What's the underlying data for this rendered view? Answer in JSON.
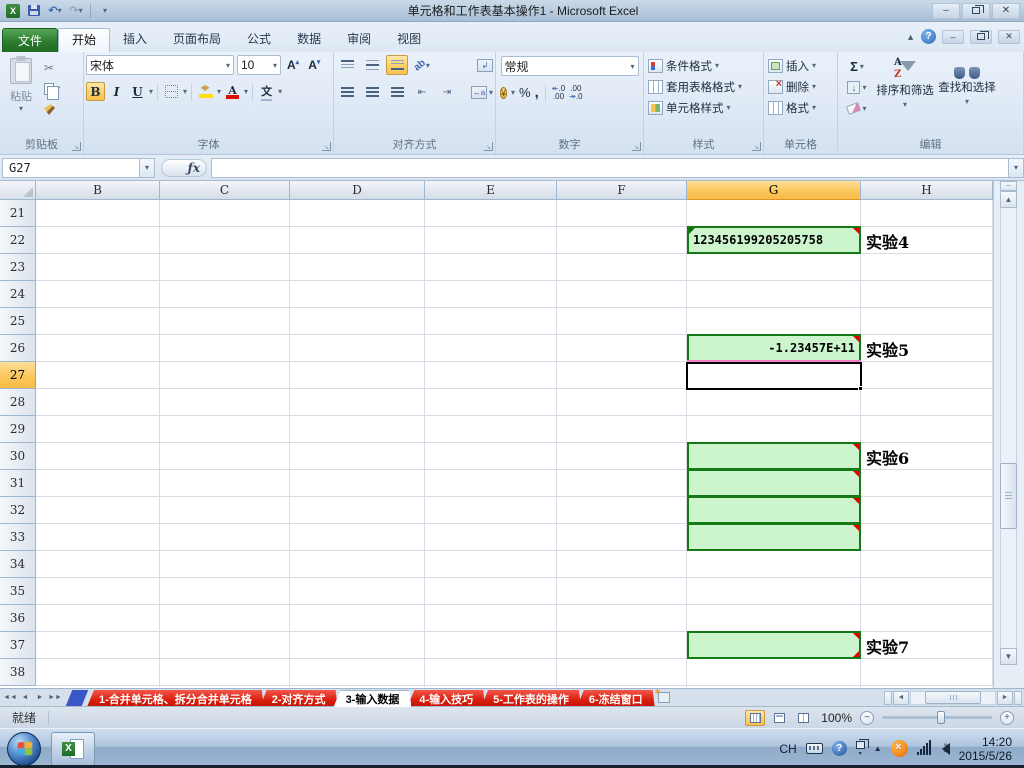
{
  "window": {
    "title": "单元格和工作表基本操作1 - Microsoft Excel"
  },
  "ribbon": {
    "file_tab": "文件",
    "tabs": [
      {
        "label": "开始",
        "active": true
      },
      {
        "label": "插入"
      },
      {
        "label": "页面布局"
      },
      {
        "label": "公式"
      },
      {
        "label": "数据"
      },
      {
        "label": "审阅"
      },
      {
        "label": "视图"
      }
    ],
    "groups": {
      "clipboard": {
        "label": "剪贴板",
        "paste": "粘贴"
      },
      "font": {
        "label": "字体",
        "name": "宋体",
        "size": "10"
      },
      "alignment": {
        "label": "对齐方式"
      },
      "number": {
        "label": "数字",
        "format": "常规"
      },
      "styles": {
        "label": "样式",
        "items": [
          "条件格式",
          "套用表格格式",
          "单元格样式"
        ]
      },
      "cells": {
        "label": "单元格",
        "items": [
          "插入",
          "删除",
          "格式"
        ]
      },
      "editing": {
        "label": "编辑",
        "sort": "排序和筛选",
        "find": "查找和选择"
      }
    }
  },
  "formula_bar": {
    "name_box": "G27",
    "formula": ""
  },
  "grid": {
    "columns": [
      "B",
      "C",
      "D",
      "E",
      "F",
      "G",
      "H"
    ],
    "selected_column": "G",
    "rows": [
      "21",
      "22",
      "23",
      "24",
      "25",
      "26",
      "27",
      "28",
      "29",
      "30",
      "31",
      "32",
      "33",
      "34",
      "35",
      "36",
      "37",
      "38"
    ],
    "selected_row": "27",
    "active_cell": "G27",
    "boxes": [
      {
        "ref": "G22",
        "row": "22",
        "value": "123456199205205758",
        "align": "left",
        "comment": true,
        "error_tag": true
      },
      {
        "ref": "G26",
        "row": "26",
        "value": "-1.23457E+11",
        "align": "right",
        "comment": true,
        "pink_bottom": true
      },
      {
        "ref": "G30",
        "row": "30",
        "value": "",
        "comment": true
      },
      {
        "ref": "G31",
        "row": "31",
        "value": "",
        "comment": true
      },
      {
        "ref": "G32",
        "row": "32",
        "value": "",
        "comment": true
      },
      {
        "ref": "G33",
        "row": "33",
        "value": "",
        "comment": true
      },
      {
        "ref": "G37",
        "row": "37",
        "value": "",
        "comment": true,
        "comment_bottom": true
      }
    ],
    "labels": [
      {
        "row": "22",
        "text": "实验4"
      },
      {
        "row": "26",
        "text": "实验5"
      },
      {
        "row": "30",
        "text": "实验6"
      },
      {
        "row": "37",
        "text": "实验7"
      }
    ]
  },
  "sheet_tabs": {
    "items": [
      {
        "label": "1-合并单元格、拆分合并单元格",
        "color": "red"
      },
      {
        "label": "2-对齐方式",
        "color": "red"
      },
      {
        "label": "3-输入数据",
        "active": true
      },
      {
        "label": "4-输入技巧",
        "color": "red"
      },
      {
        "label": "5-工作表的操作",
        "color": "red"
      },
      {
        "label": "6-冻结窗口",
        "color": "red"
      }
    ]
  },
  "status_bar": {
    "mode": "就绪",
    "zoom": "100%"
  },
  "taskbar": {
    "tray_lang": "CH",
    "time": "14:20",
    "date": "2015/5/26"
  },
  "colors": {
    "cell_fill": "#cdf5cd",
    "cell_border": "#157a15",
    "tab_red": "#d91e0e",
    "header_selected": "#fbc75c"
  }
}
